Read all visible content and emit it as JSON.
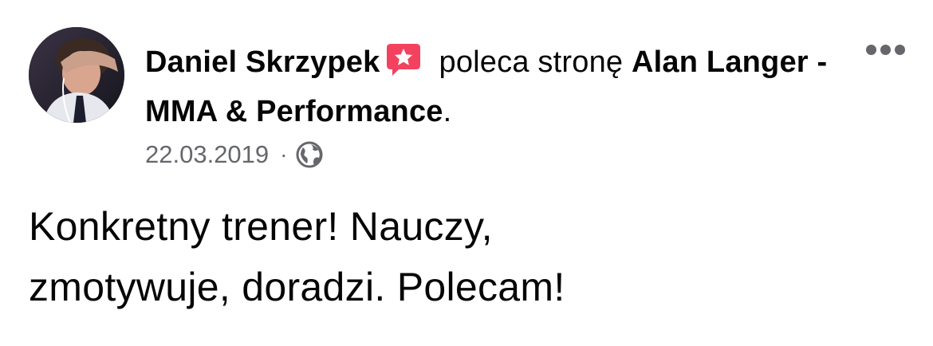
{
  "post": {
    "author_name": "Daniel Skrzypek",
    "action_text": "poleca stronę",
    "page_name": "Alan Langer - MMA & Performance",
    "period": ".",
    "date": "22.03.2019",
    "separator": "·",
    "privacy_icon": "globe-icon",
    "badge_icon": "recommendation-star-icon",
    "badge_color": "#f3425f",
    "more_icon": "more-options-icon",
    "text_line_1": "Konkretny trener! Nauczy,",
    "text_line_2": "zmotywuje, doradzi. Polecam!"
  },
  "colors": {
    "primary_text": "#050505",
    "secondary_text": "#65676b",
    "background": "#ffffff"
  }
}
